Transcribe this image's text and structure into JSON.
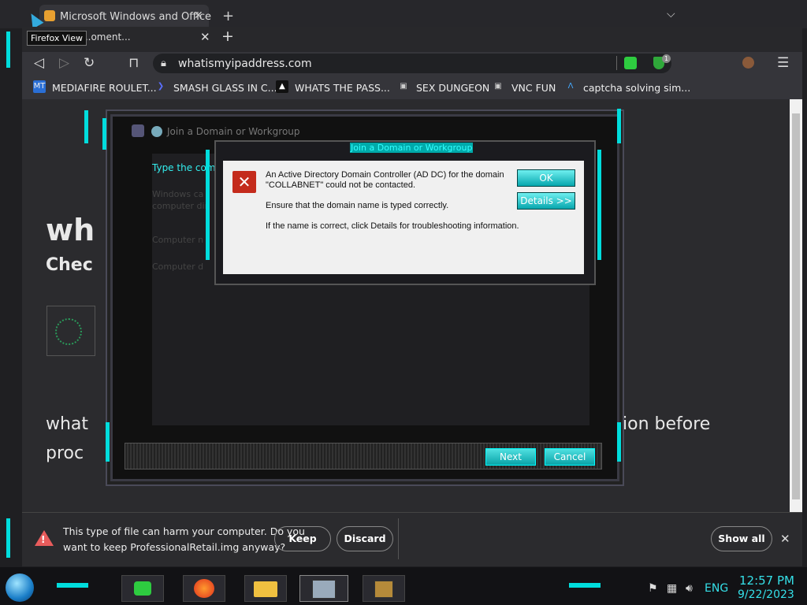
{
  "outer_window": {
    "tab_title": "Microsoft Windows and Office",
    "tooltip": "Firefox View"
  },
  "browser": {
    "tab_title": "...oment...",
    "url": "whatismyipaddress.com",
    "bookmarks": [
      {
        "label": "MEDIAFIRE ROULET...",
        "icon": "mediafire-icon"
      },
      {
        "label": "SMASH GLASS IN C...",
        "icon": "chevron-icon"
      },
      {
        "label": "WHATS THE PASS...",
        "icon": "hat-icon"
      },
      {
        "label": "SEX DUNGEON",
        "icon": "server-icon"
      },
      {
        "label": "VNC FUN",
        "icon": "server-icon"
      },
      {
        "label": "captcha solving sim...",
        "icon": "arrow-logo-icon"
      }
    ],
    "extension_badge": "1"
  },
  "page": {
    "heading_partial": "wh",
    "subheading_partial": "Chec",
    "line1_left": "what",
    "line1_right": "ion before",
    "line2_left": "proc"
  },
  "wizard": {
    "title": "Join a Domain or Workgroup",
    "body_heading": "Type the com",
    "body_line1": "Windows ca",
    "body_line2": "computer dir",
    "label_computer_name": "Computer n",
    "label_computer_domain": "Computer d",
    "next_label": "Next",
    "cancel_label": "Cancel"
  },
  "dialog": {
    "title": "Join a Domain or Workgroup",
    "line1": "An Active Directory Domain Controller (AD DC) for the domain",
    "line2": "\"COLLABNET\" could not be contacted.",
    "line3": "Ensure that the domain name is typed correctly.",
    "line4": "If the name is correct, click Details for troubleshooting information.",
    "ok_label": "OK",
    "details_label": "Details >>"
  },
  "download_bar": {
    "line1": "This type of file can harm your computer. Do you",
    "line2": "want to keep ProfessionalRetail.img anyway?",
    "keep_label": "Keep",
    "discard_label": "Discard",
    "show_all_label": "Show all"
  },
  "taskbar": {
    "lang": "ENG",
    "time": "12:57 PM",
    "date": "9/22/2023"
  },
  "colors": {
    "accent": "#35e0e8",
    "error": "#c42b1c",
    "dialog_bg": "#f0f0f0"
  }
}
